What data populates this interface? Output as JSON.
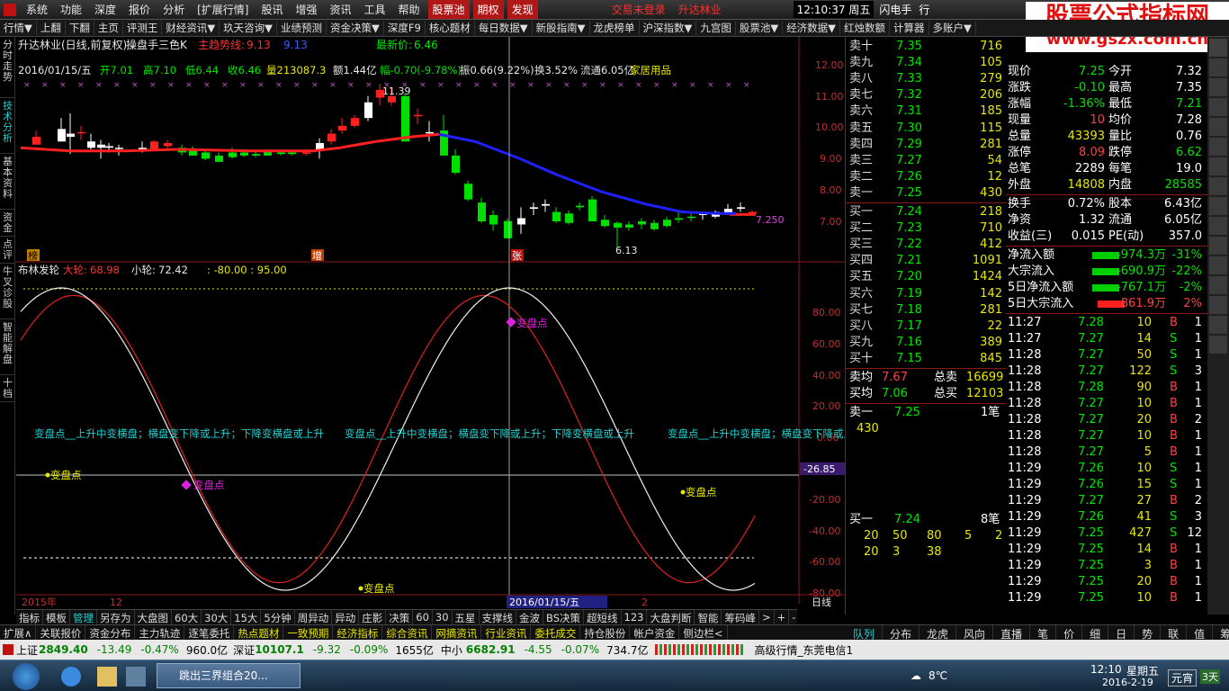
{
  "menubar": {
    "items": [
      "系统",
      "功能",
      "深度",
      "报价",
      "分析",
      "[扩展行情]",
      "股讯",
      "增强",
      "资讯",
      "工具",
      "帮助"
    ],
    "highlights": [
      "股票池",
      "期权",
      "发现"
    ],
    "trade_status": "交易未登录",
    "stock": "升达林业",
    "clock": "12:10:37 周五",
    "flash": "闪电手",
    "trade": "行"
  },
  "watermark": {
    "title": "股票公式指标网",
    "url": "www.gszx.com.cn"
  },
  "toolbar": {
    "items": [
      "行情▼",
      "上翻",
      "下翻",
      "主页",
      "评测王",
      "财经资讯▼",
      "玖天咨询▼",
      "业绩预测",
      "资金决策▼",
      "深度F9",
      "核心题材",
      "每日数据▼",
      "新股指南▼",
      "龙虎榜单",
      "沪深指数▼",
      "九宫图",
      "股票池▼",
      "经济数据▼",
      "红烛数额",
      "计算器",
      "多账户▼"
    ]
  },
  "sidetabs": [
    "分时走势",
    "技术分析",
    "基本资料",
    "资金",
    "点评",
    "牛叉诊股",
    "智能解盘",
    "十档"
  ],
  "kline": {
    "title": "升达林业(日线,前复权)",
    "indicator": "操盘手三色K",
    "trend_label": "主趋势线:",
    "trend_val": "9.13",
    "trend_val2": "9.13",
    "newest_label": "最新价:",
    "newest_val": "6.46",
    "info_date": "2016/01/15/五",
    "info_open": "开7.01",
    "info_high": "高7.10",
    "info_low": "低6.44",
    "info_close": "收6.46",
    "info_vol": "量213087.3",
    "info_amt": "额1.44亿",
    "info_chg": "幅-0.70(-9.78%)",
    "info_amp": "振0.66(9.22%)",
    "info_turn": "换3.52%",
    "info_cap": "流通6.05亿",
    "info_sector": "家居用品",
    "high_marker": "11.39",
    "low_marker": "6.13",
    "price_label": "7.250",
    "tag_bang": "榜",
    "tag_zeng": "增",
    "tag_zhang": "张",
    "axis": [
      "12.00",
      "11.00",
      "10.00",
      "9.00",
      "8.00",
      "7.00"
    ]
  },
  "osc": {
    "title": "布林发轮",
    "big_label": "大轮:",
    "big_val": "68.98",
    "small_label": "小轮:",
    "small_val": "72.42",
    "range": ": -80.00 : 95.00",
    "axis": [
      "80.00",
      "60.00",
      "40.00",
      "20.00",
      "0.00",
      "-20.00",
      "-40.00",
      "-60.00",
      "-80.00"
    ],
    "current": "-26.85",
    "note": "变盘点__上升中变横盘；横盘变下降或上升；下降变横盘或上升",
    "turn_label": "变盘点",
    "xaxis_left": "2015年",
    "xaxis_12": "12",
    "xaxis_date": "2016/01/15/五",
    "xaxis_2": "2",
    "period": "日线"
  },
  "sell_book": [
    [
      "卖十",
      "7.35",
      "716"
    ],
    [
      "卖九",
      "7.34",
      "105"
    ],
    [
      "卖八",
      "7.33",
      "279"
    ],
    [
      "卖七",
      "7.32",
      "206"
    ],
    [
      "卖六",
      "7.31",
      "185"
    ],
    [
      "卖五",
      "7.30",
      "115"
    ],
    [
      "卖四",
      "7.29",
      "281"
    ],
    [
      "卖三",
      "7.27",
      "54"
    ],
    [
      "卖二",
      "7.26",
      "12"
    ],
    [
      "卖一",
      "7.25",
      "430"
    ]
  ],
  "buy_book": [
    [
      "买一",
      "7.24",
      "218"
    ],
    [
      "买二",
      "7.23",
      "710"
    ],
    [
      "买三",
      "7.22",
      "412"
    ],
    [
      "买四",
      "7.21",
      "1091"
    ],
    [
      "买五",
      "7.20",
      "1424"
    ],
    [
      "买六",
      "7.19",
      "142"
    ],
    [
      "买七",
      "7.18",
      "281"
    ],
    [
      "买八",
      "7.17",
      "22"
    ],
    [
      "买九",
      "7.16",
      "389"
    ],
    [
      "买十",
      "7.15",
      "845"
    ]
  ],
  "avg": {
    "sell_avg_label": "卖均",
    "sell_avg": "7.67",
    "total_sell_label": "总卖",
    "total_sell": "16699",
    "buy_avg_label": "买均",
    "buy_avg": "7.06",
    "total_buy_label": "总买",
    "total_buy": "12103"
  },
  "sell_one": {
    "label": "卖一",
    "price": "7.25",
    "count": "1笔",
    "qty": "430"
  },
  "buy_one": {
    "label": "买一",
    "price": "7.24",
    "count": "8笔",
    "rows": [
      [
        "20",
        "50",
        "80",
        "5",
        "2"
      ],
      [
        "20",
        "3",
        "38",
        "",
        ""
      ]
    ]
  },
  "stats": [
    [
      "现价",
      "7.25",
      "今开",
      "7.32"
    ],
    [
      "涨跌",
      "-0.10",
      "最高",
      "7.35"
    ],
    [
      "涨幅",
      "-1.36%",
      "最低",
      "7.21"
    ],
    [
      "现量",
      "10",
      "均价",
      "7.28"
    ],
    [
      "总量",
      "43393",
      "量比",
      "0.76"
    ],
    [
      "涨停",
      "8.09",
      "跌停",
      "6.62"
    ],
    [
      "总笔",
      "2289",
      "每笔",
      "19.0"
    ],
    [
      "外盘",
      "14808",
      "内盘",
      "28585"
    ]
  ],
  "stats2": [
    [
      "换手",
      "0.72%",
      "股本",
      "6.43亿"
    ],
    [
      "净资",
      "1.32",
      "流通",
      "6.05亿"
    ],
    [
      "收益(三)",
      "0.015",
      "PE(动)",
      "357.0"
    ]
  ],
  "flows": [
    [
      "净流入额",
      "-974.3万",
      "-31%"
    ],
    [
      "大宗流入",
      "-690.9万",
      "-22%"
    ],
    [
      "5日净流入额",
      "-767.1万",
      "-2%"
    ],
    [
      "5日大宗流入",
      "861.9万",
      "2%"
    ]
  ],
  "ticks": [
    [
      "11:27",
      "7.28",
      "10",
      "B",
      "1"
    ],
    [
      "11:27",
      "7.27",
      "14",
      "S",
      "1"
    ],
    [
      "11:28",
      "7.27",
      "50",
      "S",
      "1"
    ],
    [
      "11:28",
      "7.27",
      "122",
      "S",
      "3"
    ],
    [
      "11:28",
      "7.28",
      "90",
      "B",
      "1"
    ],
    [
      "11:28",
      "7.27",
      "10",
      "B",
      "1"
    ],
    [
      "11:28",
      "7.27",
      "20",
      "B",
      "2"
    ],
    [
      "11:28",
      "7.27",
      "10",
      "B",
      "1"
    ],
    [
      "11:28",
      "7.27",
      "5",
      "B",
      "1"
    ],
    [
      "11:29",
      "7.26",
      "10",
      "S",
      "1"
    ],
    [
      "11:29",
      "7.26",
      "15",
      "S",
      "1"
    ],
    [
      "11:29",
      "7.27",
      "27",
      "B",
      "2"
    ],
    [
      "11:29",
      "7.26",
      "41",
      "S",
      "3"
    ],
    [
      "11:29",
      "7.25",
      "427",
      "S",
      "12"
    ],
    [
      "11:29",
      "7.25",
      "14",
      "B",
      "1"
    ],
    [
      "11:29",
      "7.25",
      "3",
      "B",
      "1"
    ],
    [
      "11:29",
      "7.25",
      "20",
      "B",
      "1"
    ],
    [
      "11:29",
      "7.25",
      "10",
      "B",
      "1"
    ]
  ],
  "bottomtabs": [
    "指标",
    "模板",
    "管理",
    "另存为",
    "大盘图",
    "60大",
    "30大",
    "15大",
    "5分钟",
    "周异动",
    "异动",
    "庄影",
    "决策",
    "60",
    "30",
    "五星",
    "支撑线",
    "金波",
    "BS决策",
    "超短线",
    "123",
    "大盘判断",
    "智能",
    "筹码峰",
    ">",
    "+",
    "-",
    "0"
  ],
  "bottomtabs2": [
    "扩展∧",
    "关联报价",
    "资金分布",
    "主力轨迹",
    "逐笔委托",
    "热点题材",
    "一致预期",
    "经济指标",
    "综合资讯",
    "网摘资讯",
    "行业资讯",
    "委托成交",
    "持仓股份",
    "帐户资金",
    "侧边栏<"
  ],
  "rtabs": [
    "队列",
    "分布",
    "龙虎",
    "风向",
    "直播",
    "笔",
    "价",
    "细",
    "日",
    "势",
    "联",
    "值",
    "筹"
  ],
  "indexbar": {
    "sh_label": "上证",
    "sh": "2849.40",
    "sh_chg": "-13.49",
    "sh_pct": "-0.47%",
    "sh_amt": "960.0亿",
    "sz_label": "深证",
    "sz": "10107.1",
    "sz_chg": "-9.32",
    "sz_pct": "-0.09%",
    "sz_amt": "1655亿",
    "zx_label": "中小",
    "zx": "6682.91",
    "zx_chg": "-4.55",
    "zx_pct": "-0.07%",
    "zx_amt": "734.7亿",
    "feed": "高级行情_东莞电信1"
  },
  "taskbar": {
    "window": "跳出三界组合20...",
    "temp": "8℃",
    "time": "12:10",
    "weekday": "星期五",
    "date": "2016-2-19",
    "ime": "元宵",
    "days": "3天"
  }
}
